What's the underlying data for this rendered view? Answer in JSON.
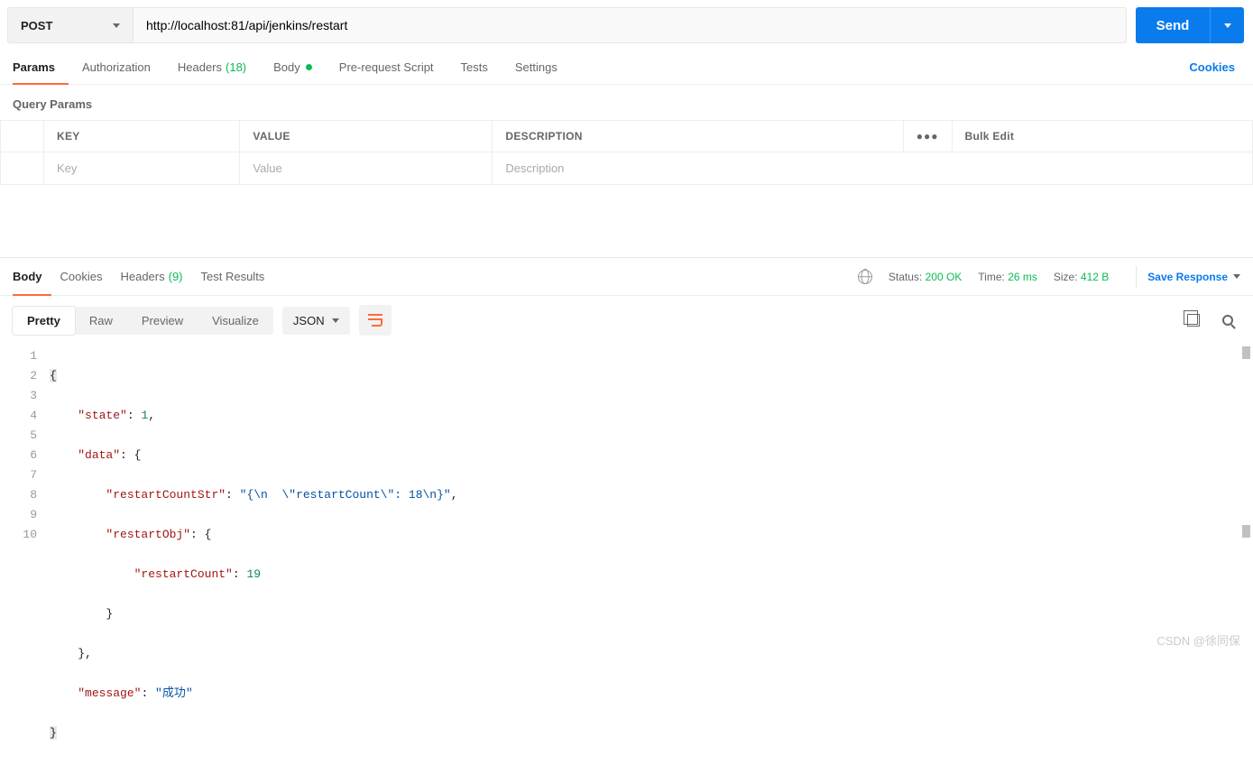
{
  "request": {
    "method": "POST",
    "url": "http://localhost:81/api/jenkins/restart",
    "send_label": "Send"
  },
  "req_tabs": {
    "params": "Params",
    "authorization": "Authorization",
    "headers": "Headers",
    "headers_count": "(18)",
    "body": "Body",
    "prerequest": "Pre-request Script",
    "tests": "Tests",
    "settings": "Settings",
    "cookies": "Cookies"
  },
  "query_params": {
    "title": "Query Params",
    "headers": {
      "key": "KEY",
      "value": "VALUE",
      "description": "DESCRIPTION"
    },
    "placeholders": {
      "key": "Key",
      "value": "Value",
      "description": "Description"
    },
    "bulk_edit": "Bulk Edit"
  },
  "resp_tabs": {
    "body": "Body",
    "cookies": "Cookies",
    "headers": "Headers",
    "headers_count": "(9)",
    "test_results": "Test Results"
  },
  "resp_meta": {
    "status_label": "Status:",
    "status_value": "200 OK",
    "time_label": "Time:",
    "time_value": "26 ms",
    "size_label": "Size:",
    "size_value": "412 B",
    "save_response": "Save Response"
  },
  "view": {
    "pretty": "Pretty",
    "raw": "Raw",
    "preview": "Preview",
    "visualize": "Visualize",
    "format": "JSON"
  },
  "code_lines": {
    "l1": "{",
    "l2a": "\"state\"",
    "l2b": ": ",
    "l2c": "1",
    "l2d": ",",
    "l3a": "\"data\"",
    "l3b": ": {",
    "l4a": "\"restartCountStr\"",
    "l4b": ": ",
    "l4c": "\"{\\n  \\\"restartCount\\\": 18\\n}\"",
    "l4d": ",",
    "l5a": "\"restartObj\"",
    "l5b": ": {",
    "l6a": "\"restartCount\"",
    "l6b": ": ",
    "l6c": "19",
    "l7": "}",
    "l8": "},",
    "l9a": "\"message\"",
    "l9b": ": ",
    "l9c": "\"成功\"",
    "l10": "}"
  },
  "line_numbers": [
    "1",
    "2",
    "3",
    "4",
    "5",
    "6",
    "7",
    "8",
    "9",
    "10"
  ],
  "watermark": "CSDN @徐同保"
}
